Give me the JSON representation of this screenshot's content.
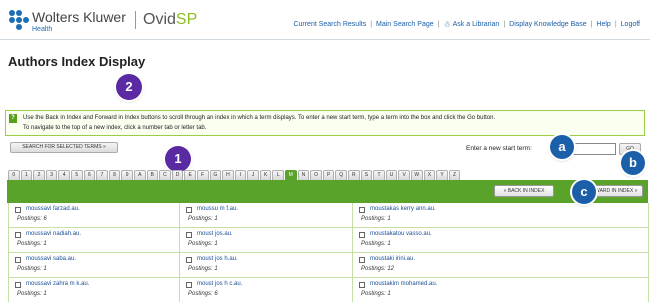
{
  "header": {
    "brand": "Wolters Kluwer",
    "brand_sub": "Health",
    "product_a": "Ovid",
    "product_b": "SP",
    "links": [
      "Current Search Results",
      "Main Search Page",
      "Ask a Librarian",
      "Display Knowledge Base",
      "Help",
      "Logoff"
    ],
    "person_icon": "person-icon"
  },
  "page": {
    "title": "Authors Index Display"
  },
  "callouts": {
    "c1": "1",
    "c2": "2",
    "ca": "a",
    "cb": "b",
    "cc": "c"
  },
  "info": {
    "icon": "?",
    "line1": "Use the Back in Index and Forward in Index buttons to scroll through an index in which a term displays. To enter a new start term, type a term into the box and click the Go button.",
    "line2": "To navigate to the top of a new index, click a number tab or letter tab."
  },
  "search": {
    "selected_button": "SEARCH FOR SELECTED TERMS »",
    "start_label": "Enter a new start term:",
    "start_value": "",
    "go_label": "GO"
  },
  "tabs": [
    "0",
    "1",
    "2",
    "3",
    "4",
    "5",
    "6",
    "7",
    "8",
    "9",
    "A",
    "B",
    "C",
    "D",
    "E",
    "F",
    "G",
    "H",
    "I",
    "J",
    "K",
    "L",
    "M",
    "N",
    "O",
    "P",
    "Q",
    "R",
    "S",
    "T",
    "U",
    "V",
    "W",
    "X",
    "Y",
    "Z"
  ],
  "active_tab": "M",
  "nav": {
    "back": "« BACK IN INDEX",
    "forward": "FORWARD IN INDEX »"
  },
  "results": [
    [
      {
        "term": "moussavi farzad.au.",
        "postings": "Postings: 6"
      },
      {
        "term": "moussu m f.au.",
        "postings": "Postings: 1"
      },
      {
        "term": "moustakas kerry ann.au.",
        "postings": "Postings: 1"
      }
    ],
    [
      {
        "term": "moussavi nadiah.au.",
        "postings": "Postings: 1"
      },
      {
        "term": "moust jos.au.",
        "postings": "Postings: 1"
      },
      {
        "term": "moustakatou vasso.au.",
        "postings": "Postings: 1"
      }
    ],
    [
      {
        "term": "moussavi saba.au.",
        "postings": "Postings: 1"
      },
      {
        "term": "moust jos h.au.",
        "postings": "Postings: 1"
      },
      {
        "term": "moustaki irini.au.",
        "postings": "Postings: 12"
      }
    ],
    [
      {
        "term": "moussavi zahra m k.au.",
        "postings": "Postings: 1"
      },
      {
        "term": "moust jos h c.au.",
        "postings": "Postings: 6"
      },
      {
        "term": "moustakim mohamed.au.",
        "postings": "Postings: 1"
      }
    ]
  ]
}
